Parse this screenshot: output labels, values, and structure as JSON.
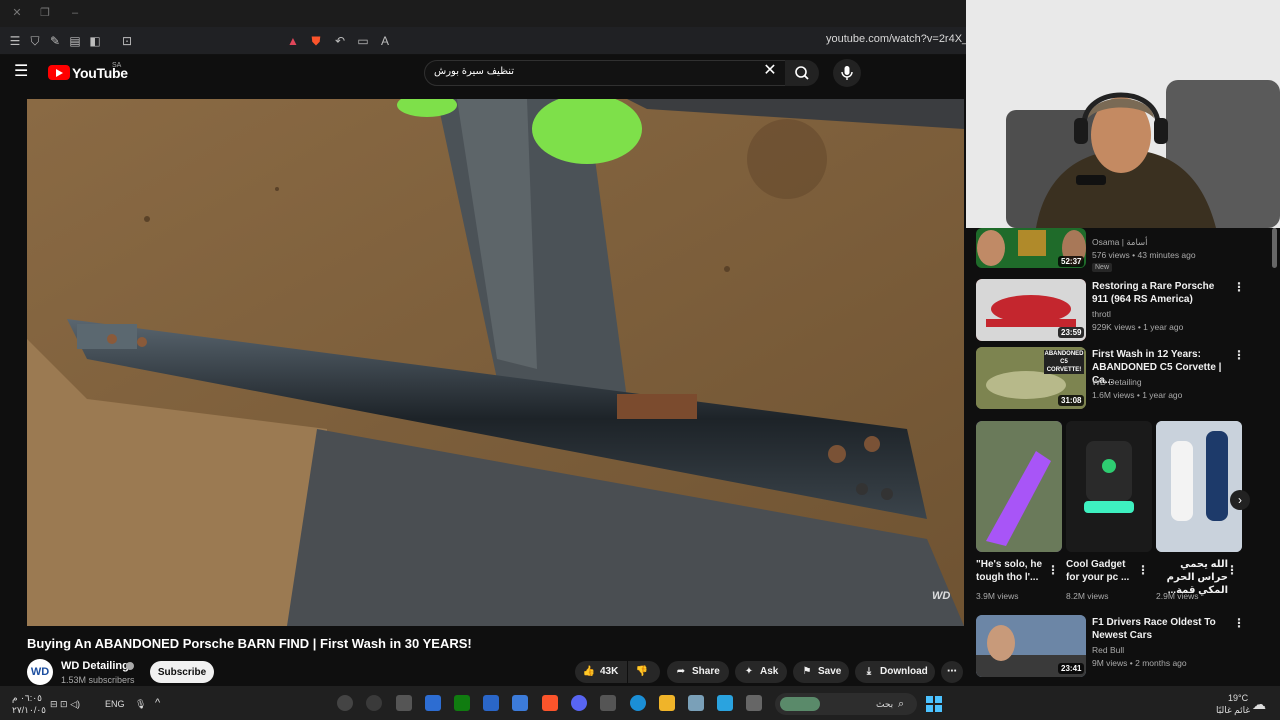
{
  "browser": {
    "url": "youtube.com/watch?v=2r4X_n8lcY"
  },
  "youtube": {
    "logo_text": "YouTube",
    "country_code": "SA",
    "search_query": "تنظيف سيرة بورش"
  },
  "video": {
    "title": "Buying An ABANDONED Porsche BARN FIND | First Wash in 30 YEARS!",
    "watermark": "WD",
    "channel": {
      "avatar_text": "WD",
      "name": "WD Detailing",
      "subscribers": "1.53M subscribers",
      "subscribe_label": "Subscribe"
    },
    "actions": {
      "like_count": "43K",
      "share_label": "Share",
      "ask_label": "Ask",
      "save_label": "Save",
      "download_label": "Download"
    }
  },
  "recommendations": [
    {
      "channel": "Osama | أسامة",
      "meta": "576 views • 43 minutes ago",
      "badge": "New",
      "duration": "52:37",
      "thumb_color": "#1f6b2a"
    },
    {
      "title": "Restoring a Rare Porsche 911 (964 RS America)",
      "channel": "throtl",
      "meta": "929K views • 1 year ago",
      "duration": "23:59",
      "thumb_color": "#c4262e"
    },
    {
      "title": "First Wash in 12 Years: ABANDONED C5 Corvette | Ca...",
      "channel": "WD Detailing",
      "meta": "1.6M views • 1 year ago",
      "duration": "31:08",
      "thumb_color": "#7d8450",
      "thumb_label": "ABANDONED C5 CORVETTE!"
    },
    {
      "title": "F1 Drivers Race Oldest To Newest Cars",
      "channel": "Red Bull",
      "meta": "9M views • 2 months ago",
      "duration": "23:41",
      "thumb_color": "#5a6f86"
    }
  ],
  "shorts": [
    {
      "title": "\"He's solo, he tough tho l'...",
      "views": "3.9M views",
      "thumb_color": "#7b3fc4"
    },
    {
      "title": "Cool Gadget for your pc ...",
      "views": "8.2M views",
      "thumb_color": "#1a1a1a"
    },
    {
      "title": "الله يحمي حراس الحرم المكي قمة...",
      "views": "2.9M views",
      "thumb_color": "#b9c4d2"
    }
  ],
  "taskbar": {
    "time": "٠٦:٠٥ م",
    "date": "٢٧/١٠/٠٥",
    "language": "ENG",
    "search_placeholder": "بحث",
    "weather_temp": "19°C",
    "weather_text": "غائم غالبًا"
  },
  "colors": {
    "youtube_red": "#ff0000",
    "background": "#0f0f0f",
    "pill": "#272727"
  }
}
